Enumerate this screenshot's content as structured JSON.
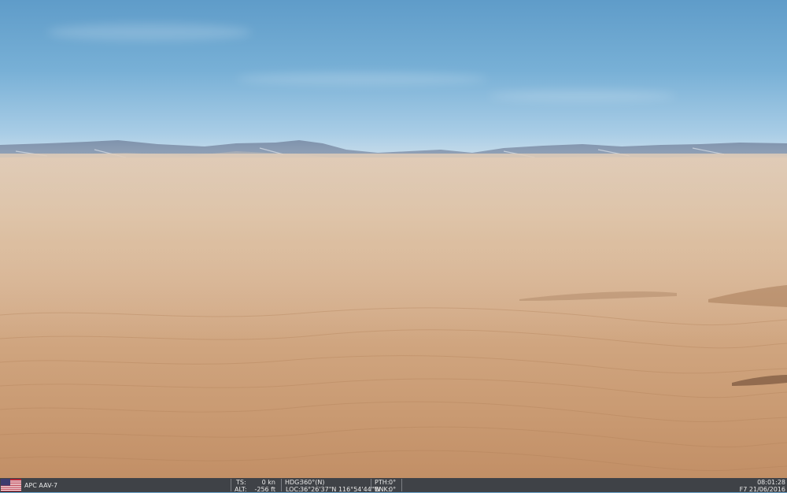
{
  "hud": {
    "vehicle": "APC AAV-7",
    "ts_label": "TS:",
    "ts_value": "0 kn",
    "alt_label": "ALT:",
    "alt_value": "-256 ft",
    "hdg_label": "HDG:",
    "hdg_value": "360°(N)",
    "loc_label": "LOC:",
    "loc_value": "36°26'37\"N 116°54'44\"W",
    "pth_label": "PTH:",
    "pth_value": "0°",
    "bnk_label": "BNK:",
    "bnk_value": "0°",
    "time": "08:01:28",
    "date": "F7 21/06/2016"
  },
  "colors": {
    "hud_bg": "#3f4247",
    "sky_top": "#5f9cc9",
    "sand": "#cfa47e"
  }
}
